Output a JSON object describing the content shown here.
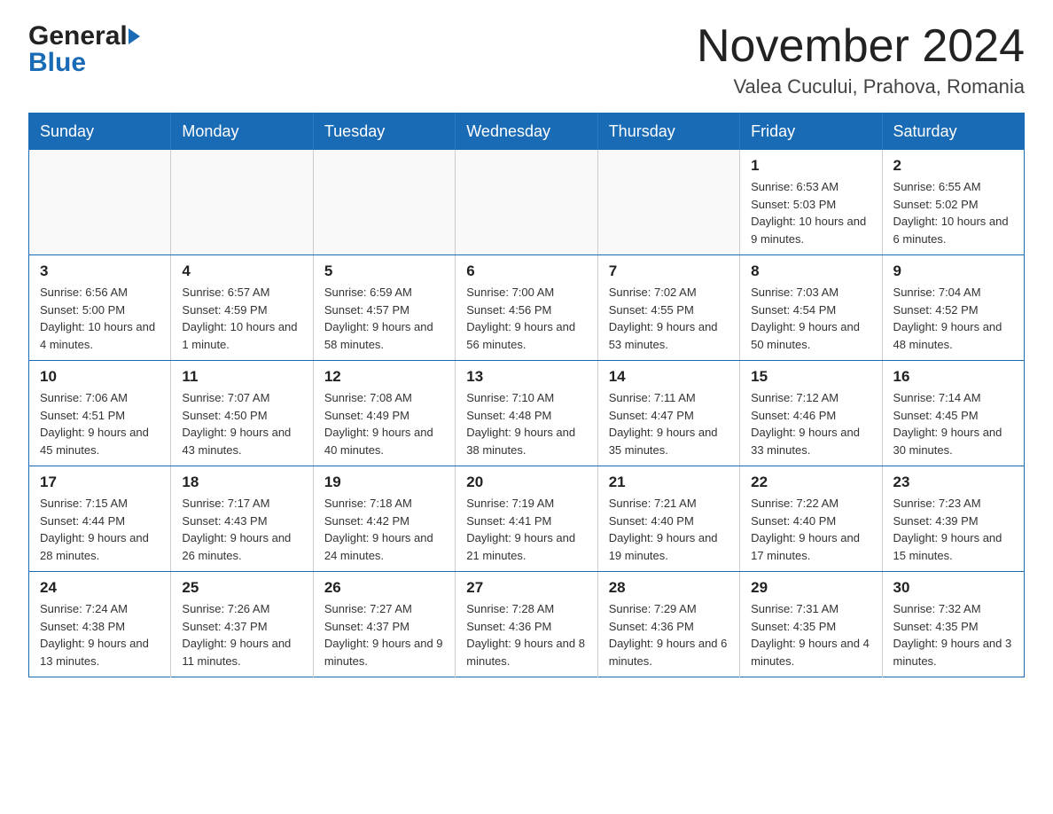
{
  "header": {
    "logo_general": "General",
    "logo_triangle": "▶",
    "logo_blue": "Blue",
    "month_title": "November 2024",
    "location": "Valea Cucului, Prahova, Romania"
  },
  "days_of_week": [
    "Sunday",
    "Monday",
    "Tuesday",
    "Wednesday",
    "Thursday",
    "Friday",
    "Saturday"
  ],
  "weeks": [
    {
      "days": [
        {
          "number": "",
          "info": ""
        },
        {
          "number": "",
          "info": ""
        },
        {
          "number": "",
          "info": ""
        },
        {
          "number": "",
          "info": ""
        },
        {
          "number": "",
          "info": ""
        },
        {
          "number": "1",
          "info": "Sunrise: 6:53 AM\nSunset: 5:03 PM\nDaylight: 10 hours and 9 minutes."
        },
        {
          "number": "2",
          "info": "Sunrise: 6:55 AM\nSunset: 5:02 PM\nDaylight: 10 hours and 6 minutes."
        }
      ]
    },
    {
      "days": [
        {
          "number": "3",
          "info": "Sunrise: 6:56 AM\nSunset: 5:00 PM\nDaylight: 10 hours and 4 minutes."
        },
        {
          "number": "4",
          "info": "Sunrise: 6:57 AM\nSunset: 4:59 PM\nDaylight: 10 hours and 1 minute."
        },
        {
          "number": "5",
          "info": "Sunrise: 6:59 AM\nSunset: 4:57 PM\nDaylight: 9 hours and 58 minutes."
        },
        {
          "number": "6",
          "info": "Sunrise: 7:00 AM\nSunset: 4:56 PM\nDaylight: 9 hours and 56 minutes."
        },
        {
          "number": "7",
          "info": "Sunrise: 7:02 AM\nSunset: 4:55 PM\nDaylight: 9 hours and 53 minutes."
        },
        {
          "number": "8",
          "info": "Sunrise: 7:03 AM\nSunset: 4:54 PM\nDaylight: 9 hours and 50 minutes."
        },
        {
          "number": "9",
          "info": "Sunrise: 7:04 AM\nSunset: 4:52 PM\nDaylight: 9 hours and 48 minutes."
        }
      ]
    },
    {
      "days": [
        {
          "number": "10",
          "info": "Sunrise: 7:06 AM\nSunset: 4:51 PM\nDaylight: 9 hours and 45 minutes."
        },
        {
          "number": "11",
          "info": "Sunrise: 7:07 AM\nSunset: 4:50 PM\nDaylight: 9 hours and 43 minutes."
        },
        {
          "number": "12",
          "info": "Sunrise: 7:08 AM\nSunset: 4:49 PM\nDaylight: 9 hours and 40 minutes."
        },
        {
          "number": "13",
          "info": "Sunrise: 7:10 AM\nSunset: 4:48 PM\nDaylight: 9 hours and 38 minutes."
        },
        {
          "number": "14",
          "info": "Sunrise: 7:11 AM\nSunset: 4:47 PM\nDaylight: 9 hours and 35 minutes."
        },
        {
          "number": "15",
          "info": "Sunrise: 7:12 AM\nSunset: 4:46 PM\nDaylight: 9 hours and 33 minutes."
        },
        {
          "number": "16",
          "info": "Sunrise: 7:14 AM\nSunset: 4:45 PM\nDaylight: 9 hours and 30 minutes."
        }
      ]
    },
    {
      "days": [
        {
          "number": "17",
          "info": "Sunrise: 7:15 AM\nSunset: 4:44 PM\nDaylight: 9 hours and 28 minutes."
        },
        {
          "number": "18",
          "info": "Sunrise: 7:17 AM\nSunset: 4:43 PM\nDaylight: 9 hours and 26 minutes."
        },
        {
          "number": "19",
          "info": "Sunrise: 7:18 AM\nSunset: 4:42 PM\nDaylight: 9 hours and 24 minutes."
        },
        {
          "number": "20",
          "info": "Sunrise: 7:19 AM\nSunset: 4:41 PM\nDaylight: 9 hours and 21 minutes."
        },
        {
          "number": "21",
          "info": "Sunrise: 7:21 AM\nSunset: 4:40 PM\nDaylight: 9 hours and 19 minutes."
        },
        {
          "number": "22",
          "info": "Sunrise: 7:22 AM\nSunset: 4:40 PM\nDaylight: 9 hours and 17 minutes."
        },
        {
          "number": "23",
          "info": "Sunrise: 7:23 AM\nSunset: 4:39 PM\nDaylight: 9 hours and 15 minutes."
        }
      ]
    },
    {
      "days": [
        {
          "number": "24",
          "info": "Sunrise: 7:24 AM\nSunset: 4:38 PM\nDaylight: 9 hours and 13 minutes."
        },
        {
          "number": "25",
          "info": "Sunrise: 7:26 AM\nSunset: 4:37 PM\nDaylight: 9 hours and 11 minutes."
        },
        {
          "number": "26",
          "info": "Sunrise: 7:27 AM\nSunset: 4:37 PM\nDaylight: 9 hours and 9 minutes."
        },
        {
          "number": "27",
          "info": "Sunrise: 7:28 AM\nSunset: 4:36 PM\nDaylight: 9 hours and 8 minutes."
        },
        {
          "number": "28",
          "info": "Sunrise: 7:29 AM\nSunset: 4:36 PM\nDaylight: 9 hours and 6 minutes."
        },
        {
          "number": "29",
          "info": "Sunrise: 7:31 AM\nSunset: 4:35 PM\nDaylight: 9 hours and 4 minutes."
        },
        {
          "number": "30",
          "info": "Sunrise: 7:32 AM\nSunset: 4:35 PM\nDaylight: 9 hours and 3 minutes."
        }
      ]
    }
  ]
}
